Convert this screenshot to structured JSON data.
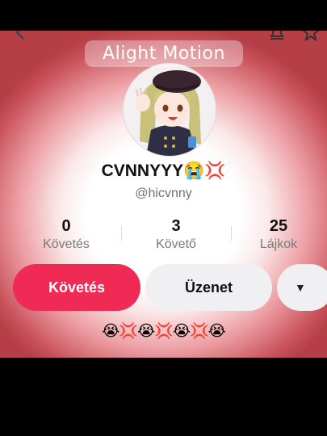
{
  "watermark": "Alight Motion",
  "profile": {
    "display_name": "CVNNYYY😭💢",
    "handle": "@hicvnny",
    "bio": "😭💢😭💢😭💢😭"
  },
  "stats": [
    {
      "value": "0",
      "label": "Követés"
    },
    {
      "value": "3",
      "label": "Követő"
    },
    {
      "value": "25",
      "label": "Lájkok"
    }
  ],
  "buttons": {
    "follow": "Követés",
    "message": "Üzenet",
    "more": "▼"
  },
  "colors": {
    "accent": "#ee2a55",
    "secondary_button": "#f0f0f2"
  },
  "icons": [
    "back-icon",
    "bell-icon",
    "share-icon",
    "chevron-down-icon"
  ]
}
